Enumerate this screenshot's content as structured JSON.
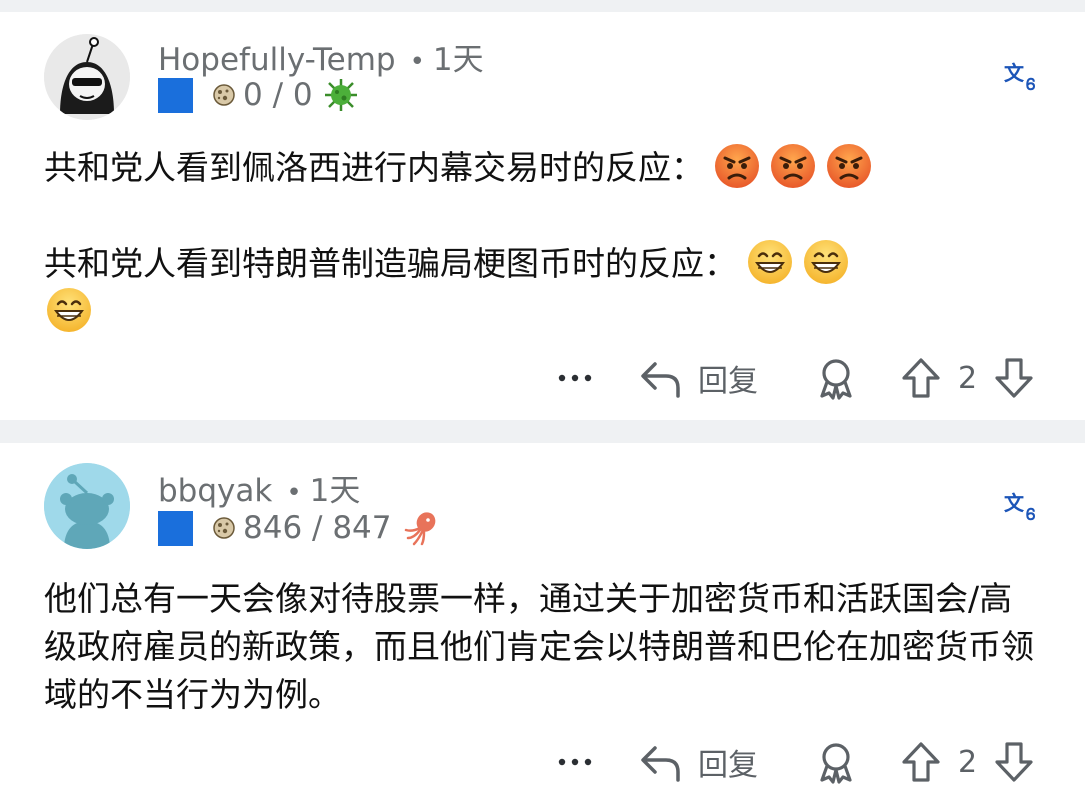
{
  "comments": [
    {
      "username": "Hopefully-Temp",
      "separator": "•",
      "time": "1天",
      "karma": "0 / 0",
      "flair_badge": "virus-badge-icon",
      "paragraphs": [
        "共和党人看到佩洛西进行内幕交易时的反应：",
        "共和党人看到特朗普制造骗局梗图币时的反应："
      ],
      "paragraph_emojis": [
        "angry-face",
        "grinning-face"
      ],
      "reply_label": "回复",
      "vote_count": "2"
    },
    {
      "username": "bbqyak",
      "separator": "•",
      "time": "1天",
      "karma": "846 / 847",
      "flair_badge": "squid-badge-icon",
      "paragraphs": [
        "他们总有一天会像对待股票一样，通过关于加密货币和活跃国会/高级政府雇员的新政策，而且他们肯定会以特朗普和巴伦在加密货币领域的不当行为为例。"
      ],
      "reply_label": "回复",
      "vote_count": "2"
    }
  ],
  "colors": {
    "flair_square": "#1a6fdc",
    "meta_text": "#6b6f72",
    "translate_icon": "#1c55b8",
    "separator_band": "#eff1f3"
  }
}
